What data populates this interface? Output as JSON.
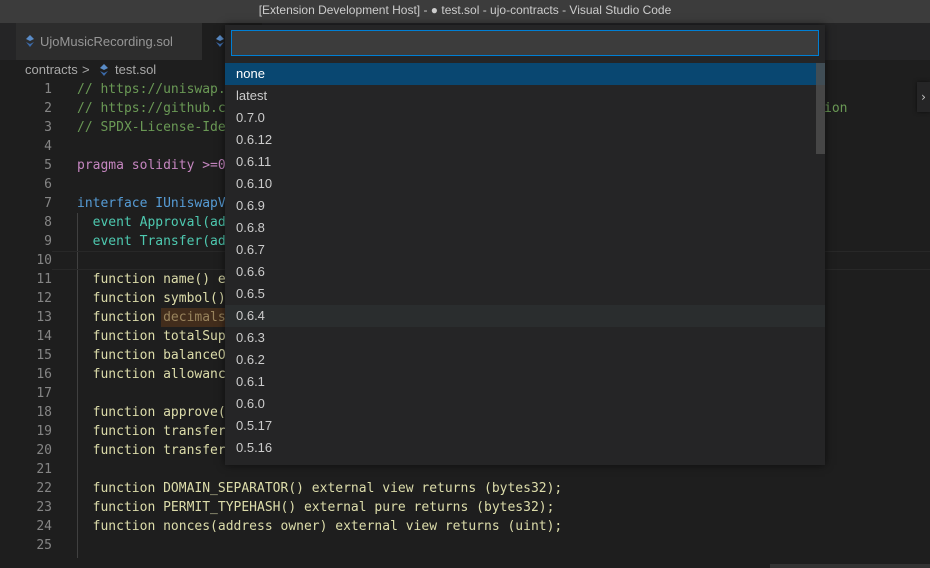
{
  "window": {
    "title": "[Extension Development Host] - ● test.sol - ujo-contracts - Visual Studio Code"
  },
  "tabs": [
    {
      "label": "UjoMusicRecording.sol",
      "active": false
    },
    {
      "label": "",
      "active": true
    }
  ],
  "breadcrumb": {
    "folder": "contracts",
    "separator": ">",
    "file": "test.sol"
  },
  "editor": {
    "lines": [
      {
        "num": "1",
        "text": "// https://uniswap."
      },
      {
        "num": "2",
        "text": "// https://github.co",
        "tail": "ion"
      },
      {
        "num": "3",
        "text": "// SPDX-License-Ide"
      },
      {
        "num": "4",
        "text": ""
      },
      {
        "num": "5",
        "text": "pragma solidity >=0"
      },
      {
        "num": "6",
        "text": ""
      },
      {
        "num": "7",
        "text": "interface IUniswapV"
      },
      {
        "num": "8",
        "text": "  event Approval(add"
      },
      {
        "num": "9",
        "text": "  event Transfer(add"
      },
      {
        "num": "10",
        "text": ""
      },
      {
        "num": "11",
        "text": "  function name() e"
      },
      {
        "num": "12",
        "text": "  function symbol()"
      },
      {
        "num": "13",
        "text": "  function decimals"
      },
      {
        "num": "14",
        "text": "  function totalSupp"
      },
      {
        "num": "15",
        "text": "  function balanceOf"
      },
      {
        "num": "16",
        "text": "  function allowance"
      },
      {
        "num": "17",
        "text": ""
      },
      {
        "num": "18",
        "text": "  function approve(a"
      },
      {
        "num": "19",
        "text": "  function transfer"
      },
      {
        "num": "20",
        "text": "  function transfer"
      },
      {
        "num": "21",
        "text": ""
      },
      {
        "num": "22",
        "text": "  function DOMAIN_SEPARATOR() external view returns (bytes32);"
      },
      {
        "num": "23",
        "text": "  function PERMIT_TYPEHASH() external pure returns (bytes32);"
      },
      {
        "num": "24",
        "text": "  function nonces(address owner) external view returns (uint);"
      },
      {
        "num": "25",
        "text": ""
      }
    ]
  },
  "quick_pick": {
    "input_value": "",
    "items": [
      "none",
      "latest",
      "0.7.0",
      "0.6.12",
      "0.6.11",
      "0.6.10",
      "0.6.9",
      "0.6.8",
      "0.6.7",
      "0.6.6",
      "0.6.5",
      "0.6.4",
      "0.6.3",
      "0.6.2",
      "0.6.1",
      "0.6.0",
      "0.5.17",
      "0.5.16"
    ],
    "selected": "none",
    "hovered": "0.6.4"
  },
  "colors": {
    "accent": "#007fd4",
    "selection": "#094771",
    "comment": "#6a9955",
    "keyword": "#c586c0",
    "function": "#dcdcaa"
  }
}
